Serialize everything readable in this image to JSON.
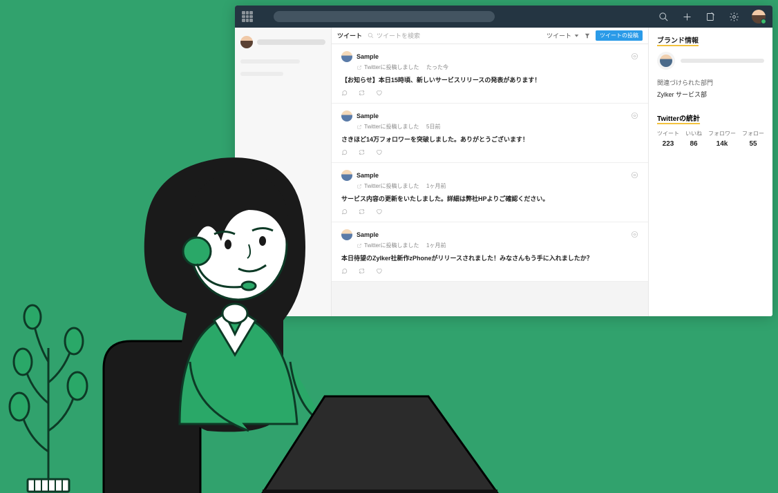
{
  "feed": {
    "tab_label": "ツイート",
    "search_placeholder": "ツイートを検索",
    "dropdown_label": "ツイート",
    "compose_label": "ツイートの投稿",
    "posts": [
      {
        "name": "Sample",
        "meta": "Twitterに投稿しました",
        "time": "たった今",
        "body": "【お知らせ】本日15時頃、新しいサービスリリースの発表があります！"
      },
      {
        "name": "Sample",
        "meta": "Twitterに投稿しました",
        "time": "5日前",
        "body": "さきほど14万フォロワーを突破しました。ありがとうございます！"
      },
      {
        "name": "Sample",
        "meta": "Twitterに投稿しました",
        "time": "1ヶ月前",
        "body": "サービス内容の更新をいたしました。詳細は弊社HPよりご確認ください。"
      },
      {
        "name": "Sample",
        "meta": "Twitterに投稿しました",
        "time": "1ヶ月前",
        "body": "本日待望のZylker社新作zPhoneがリリースされました！みなさんもう手に入れましたか？"
      }
    ]
  },
  "brand": {
    "title": "ブランド情報",
    "dept_label": "関連づけられた部門",
    "dept_value": "Zylker サービス部"
  },
  "stats": {
    "title": "Twitterの統計",
    "items": [
      {
        "label": "ツイート",
        "value": "223"
      },
      {
        "label": "いいね",
        "value": "86"
      },
      {
        "label": "フォロワー",
        "value": "14k"
      },
      {
        "label": "フォロー",
        "value": "55"
      }
    ]
  }
}
